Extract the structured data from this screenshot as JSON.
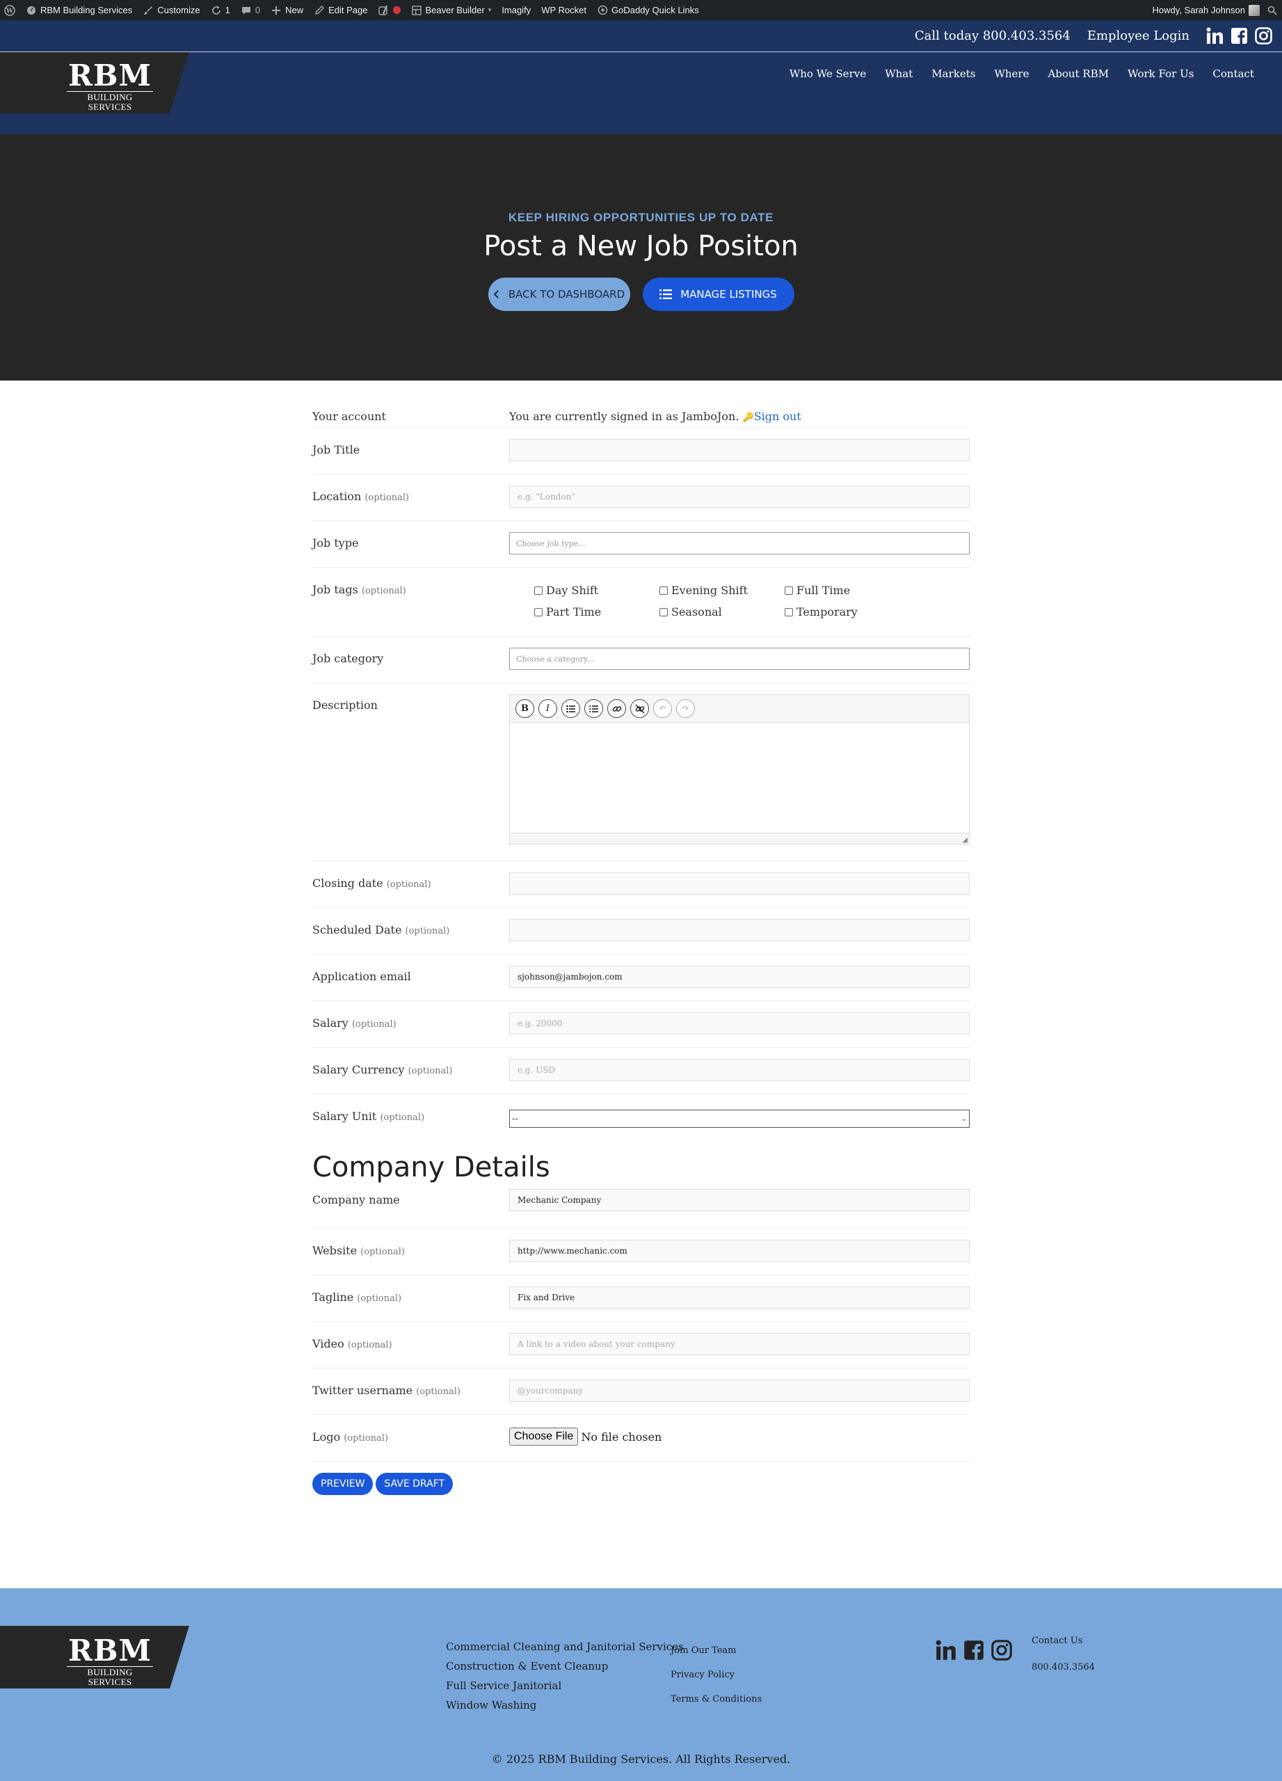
{
  "adminbar": {
    "site": "RBM Building Services",
    "customize": "Customize",
    "updates": "1",
    "comments": "0",
    "new": "New",
    "edit_page": "Edit Page",
    "beaver": "Beaver Builder",
    "imagify": "Imagify",
    "wprocket": "WP Rocket",
    "godaddy": "GoDaddy Quick Links",
    "howdy": "Howdy, Sarah Johnson"
  },
  "header": {
    "call": "Call today 800.403.3564",
    "employee_login": "Employee Login",
    "logo_main": "RBM",
    "logo_sub": "BUILDING SERVICES",
    "nav": [
      "Who We Serve",
      "What",
      "Markets",
      "Where",
      "About RBM",
      "Work For Us",
      "Contact"
    ]
  },
  "hero": {
    "eyebrow": "KEEP HIRING OPPORTUNITIES UP TO DATE",
    "title": "Post a New Job Positon",
    "back_btn": "BACK TO DASHBOARD",
    "manage_btn": "MANAGE LISTINGS"
  },
  "form": {
    "account_label": "Your account",
    "account_text": "You are currently signed in as JamboJon.",
    "sign_out": "Sign out",
    "job_title_label": "Job Title",
    "job_title_value": "",
    "location_label": "Location",
    "location_placeholder": "e.g. \"London\"",
    "job_type_label": "Job type",
    "job_type_placeholder": "Choose job type...",
    "job_tags_label": "Job tags",
    "job_tags": [
      "Day Shift",
      "Evening Shift",
      "Full Time",
      "Part Time",
      "Seasonal",
      "Temporary"
    ],
    "job_category_label": "Job category",
    "job_category_placeholder": "Choose a category...",
    "description_label": "Description",
    "closing_date_label": "Closing date",
    "scheduled_date_label": "Scheduled Date",
    "app_email_label": "Application email",
    "app_email_value": "sjohnson@jambojon.com",
    "salary_label": "Salary",
    "salary_placeholder": "e.g. 20000",
    "currency_label": "Salary Currency",
    "currency_placeholder": "e.g. USD",
    "unit_label": "Salary Unit",
    "unit_value": "--",
    "optional": "(optional)"
  },
  "company": {
    "heading": "Company Details",
    "name_label": "Company name",
    "name_value": "Mechanic Company",
    "website_label": "Website",
    "website_value": "http://www.mechanic.com",
    "tagline_label": "Tagline",
    "tagline_value": "Fix and Drive",
    "video_label": "Video",
    "video_placeholder": "A link to a video about your company",
    "twitter_label": "Twitter username",
    "twitter_placeholder": "@yourcompany",
    "logo_label": "Logo",
    "choose_file": "Choose File",
    "no_file": "No file chosen"
  },
  "actions": {
    "preview": "PREVIEW",
    "save_draft": "SAVE DRAFT"
  },
  "footer": {
    "services": [
      "Commercial Cleaning and Janitorial Services",
      "Construction & Event Cleanup",
      "Full Service Janitorial",
      "Window Washing"
    ],
    "links": [
      "Join Our Team",
      "Privacy Policy",
      "Terms & Conditions"
    ],
    "contact_us": "Contact Us",
    "phone": "800.403.3564",
    "copyright": "© 2025 RBM Building Services. All Rights Reserved."
  },
  "colors": {
    "header_navy": "#1d3461",
    "hero_dark": "#262626",
    "accent_blue": "#1a57db",
    "light_blue": "#7aa7db"
  }
}
